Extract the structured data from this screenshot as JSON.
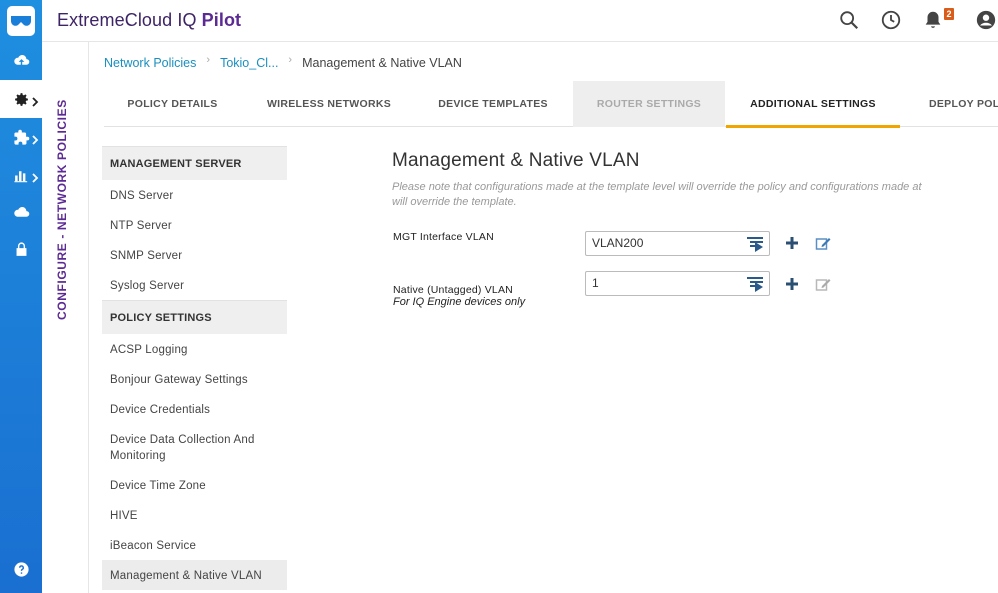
{
  "app": {
    "brand_prefix": "ExtremeCloud IQ ",
    "brand_suffix": "Pilot",
    "notification_count": "2"
  },
  "section_strip": "CONFIGURE - NETWORK POLICIES",
  "breadcrumb": {
    "root": "Network Policies",
    "policy": "Tokio_Cl...",
    "current": "Management & Native VLAN"
  },
  "tabs": [
    {
      "label": "POLICY DETAILS"
    },
    {
      "label": "WIRELESS NETWORKS"
    },
    {
      "label": "DEVICE TEMPLATES"
    },
    {
      "label": "ROUTER SETTINGS"
    },
    {
      "label": "ADDITIONAL SETTINGS"
    },
    {
      "label": "DEPLOY POLIC"
    }
  ],
  "menu": {
    "management_server": "MANAGEMENT SERVER",
    "management_items": [
      "DNS Server",
      "NTP Server",
      "SNMP Server",
      "Syslog Server"
    ],
    "policy_settings": "POLICY SETTINGS",
    "policy_items": [
      "ACSP Logging",
      "Bonjour Gateway Settings",
      "Device Credentials",
      "Device Data Collection And Monitoring",
      "Device Time Zone",
      "HIVE",
      "iBeacon Service",
      "Management & Native VLAN"
    ]
  },
  "main": {
    "title": "Management & Native VLAN",
    "note_line1": "Please note that configurations made at the template level will override the policy and configurations made at",
    "note_line2": "will override the template.",
    "mgt_label": "MGT Interface VLAN",
    "mgt_value": "VLAN200",
    "native_label": "Native (Untagged) VLAN",
    "native_sub": "For IQ Engine devices only",
    "native_value": "1"
  },
  "colors": {
    "rail": "#1a7fd8",
    "brand_purple": "#5b2a93",
    "link": "#1a8fbf",
    "active_tab": "#f0a500",
    "badge": "#d95c1a"
  }
}
